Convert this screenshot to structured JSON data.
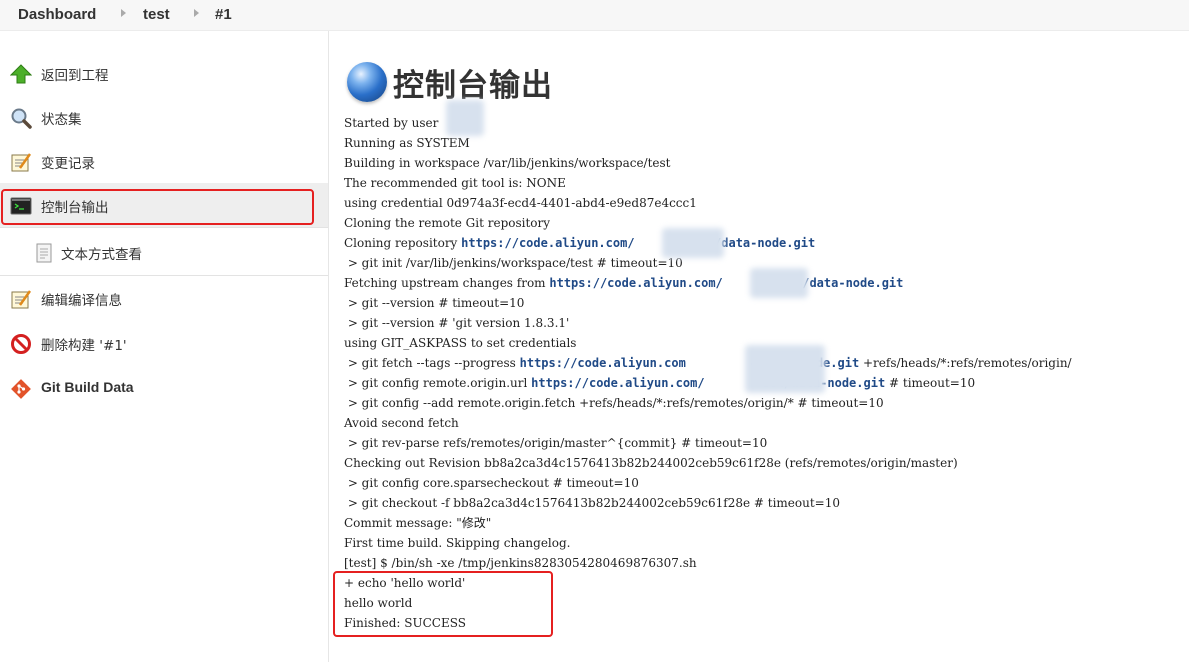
{
  "breadcrumb": {
    "items": [
      "Dashboard",
      "test",
      "#1"
    ]
  },
  "sidebar": {
    "items": [
      {
        "label": "返回到工程",
        "icon": "up-arrow-icon"
      },
      {
        "label": "状态集",
        "icon": "magnifier-icon"
      },
      {
        "label": "变更记录",
        "icon": "notepad-icon"
      },
      {
        "label": "控制台输出",
        "icon": "terminal-icon",
        "active": true
      },
      {
        "label": "文本方式查看",
        "icon": "document-icon"
      },
      {
        "label": "编辑编译信息",
        "icon": "notepad-icon"
      },
      {
        "label": "删除构建 '#1'",
        "icon": "no-entry-icon"
      },
      {
        "label": "Git Build Data",
        "icon": "git-icon"
      }
    ]
  },
  "main": {
    "title": "控制台输出",
    "console_lines": [
      "Started by user",
      "Running as SYSTEM",
      "Building in workspace /var/lib/jenkins/workspace/test",
      "The recommended git tool is: NONE",
      "using credential 0d974a3f-ecd4-4401-abd4-e9ed87e4ccc1",
      "Cloning the remote Git repository",
      {
        "pre": "Cloning repository ",
        "link": "https://code.aliyun.com/        804/data-node.git",
        "post": ""
      },
      " > git init /var/lib/jenkins/workspace/test # timeout=10",
      {
        "pre": "Fetching upstream changes from ",
        "link": "https://code.aliyun.com/        804/data-node.git",
        "post": ""
      },
      " > git --version # timeout=10",
      " > git --version # 'git version 1.8.3.1'",
      "using GIT_ASKPASS to set credentials",
      {
        "pre": " > git fetch --tags --progress ",
        "link": "https://code.aliyun.com         4/data-node.git",
        "post": " +refs/heads/*:refs/remotes/origin/"
      },
      {
        "pre": " > git config remote.origin.url ",
        "link": "https://code.aliyun.com/        804/data-node.git",
        "post": " # timeout=10"
      },
      " > git config --add remote.origin.fetch +refs/heads/*:refs/remotes/origin/* # timeout=10",
      "Avoid second fetch",
      " > git rev-parse refs/remotes/origin/master^{commit} # timeout=10",
      "Checking out Revision bb8a2ca3d4c1576413b82b244002ceb59c61f28e (refs/remotes/origin/master)",
      " > git config core.sparsecheckout # timeout=10",
      " > git checkout -f bb8a2ca3d4c1576413b82b244002ceb59c61f28e # timeout=10",
      "Commit message: \"修改\"",
      "First time build. Skipping changelog.",
      "[test] $ /bin/sh -xe /tmp/jenkins8283054280469876307.sh",
      "+ echo 'hello world'",
      "hello world",
      "Finished: SUCCESS"
    ]
  },
  "colors": {
    "highlight": "#e52020",
    "link": "#204a87"
  }
}
